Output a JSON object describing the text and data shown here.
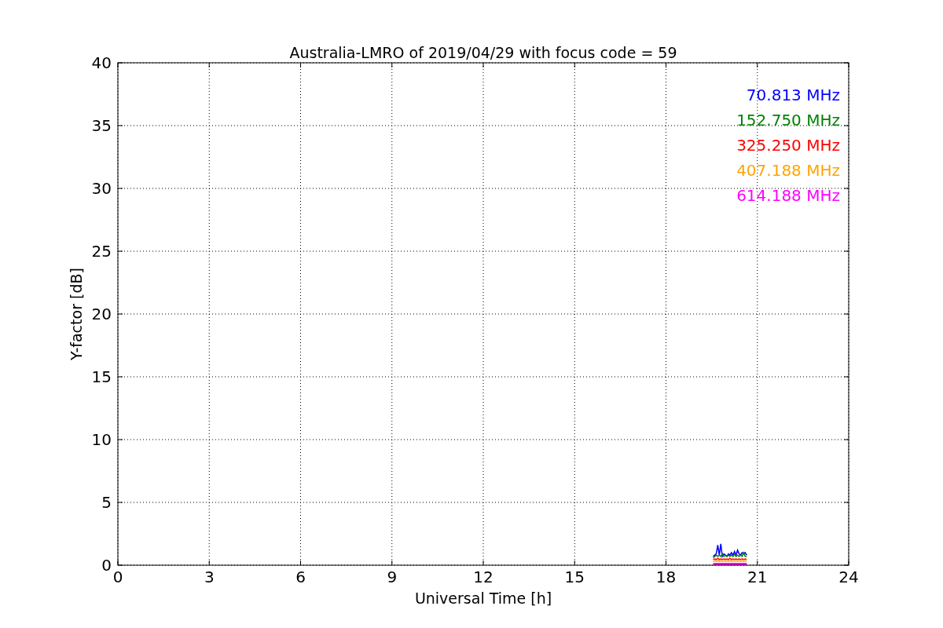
{
  "chart_data": {
    "type": "line",
    "title": "Australia-LMRO of 2019/04/29 with focus code = 59",
    "xlabel": "Universal Time [h]",
    "ylabel": "Y-factor [dB]",
    "x": [
      19.55,
      19.6,
      19.65,
      19.7,
      19.75,
      19.8,
      19.85,
      19.9,
      19.95,
      20.0,
      20.05,
      20.1,
      20.15,
      20.2,
      20.25,
      20.3,
      20.35,
      20.4,
      20.45,
      20.5,
      20.55,
      20.6,
      20.65
    ],
    "series": [
      {
        "name": "70.813 MHz",
        "color": "#0000ff",
        "values": [
          0.7,
          0.8,
          0.9,
          1.6,
          0.8,
          1.7,
          0.7,
          0.9,
          0.8,
          0.7,
          0.9,
          0.8,
          1.0,
          0.8,
          1.1,
          0.8,
          1.2,
          0.9,
          0.8,
          1.0,
          0.9,
          1.0,
          0.8
        ]
      },
      {
        "name": "152.750 MHz",
        "color": "#008000",
        "values": [
          0.6,
          0.7,
          0.8,
          0.7,
          0.8,
          0.7,
          0.9,
          0.7,
          0.8,
          0.7,
          0.8,
          0.7,
          0.8,
          0.7,
          0.9,
          0.7,
          0.8,
          0.7,
          0.8,
          0.7,
          1.0,
          0.7,
          0.7
        ]
      },
      {
        "name": "325.250 MHz",
        "color": "#ff0000",
        "values": [
          0.45,
          0.5,
          0.45,
          0.55,
          0.45,
          0.5,
          0.45,
          0.5,
          0.45,
          0.5,
          0.45,
          0.55,
          0.45,
          0.5,
          0.45,
          0.5,
          0.45,
          0.5,
          0.45,
          0.5,
          0.45,
          0.5,
          0.45
        ]
      },
      {
        "name": "407.188 MHz",
        "color": "#ffa500",
        "values": [
          0.3,
          0.35,
          0.3,
          0.35,
          0.3,
          0.35,
          0.3,
          0.35,
          0.3,
          0.35,
          0.3,
          0.35,
          0.3,
          0.35,
          0.3,
          0.35,
          0.3,
          0.35,
          0.3,
          0.35,
          0.3,
          0.35,
          0.3
        ]
      },
      {
        "name": "614.188 MHz",
        "color": "#ff00ff",
        "values": [
          0.1,
          0.1,
          0.1,
          0.1,
          0.1,
          0.1,
          0.1,
          0.1,
          0.1,
          0.1,
          0.1,
          0.1,
          0.1,
          0.1,
          0.1,
          0.1,
          0.1,
          0.1,
          0.1,
          0.1,
          0.1,
          0.1,
          0.1
        ]
      }
    ],
    "xlim": [
      0,
      24
    ],
    "ylim": [
      0,
      40
    ],
    "xticks": [
      0,
      3,
      6,
      9,
      12,
      15,
      18,
      21,
      24
    ],
    "yticks": [
      0,
      5,
      10,
      15,
      20,
      25,
      30,
      35,
      40
    ],
    "grid": true
  }
}
